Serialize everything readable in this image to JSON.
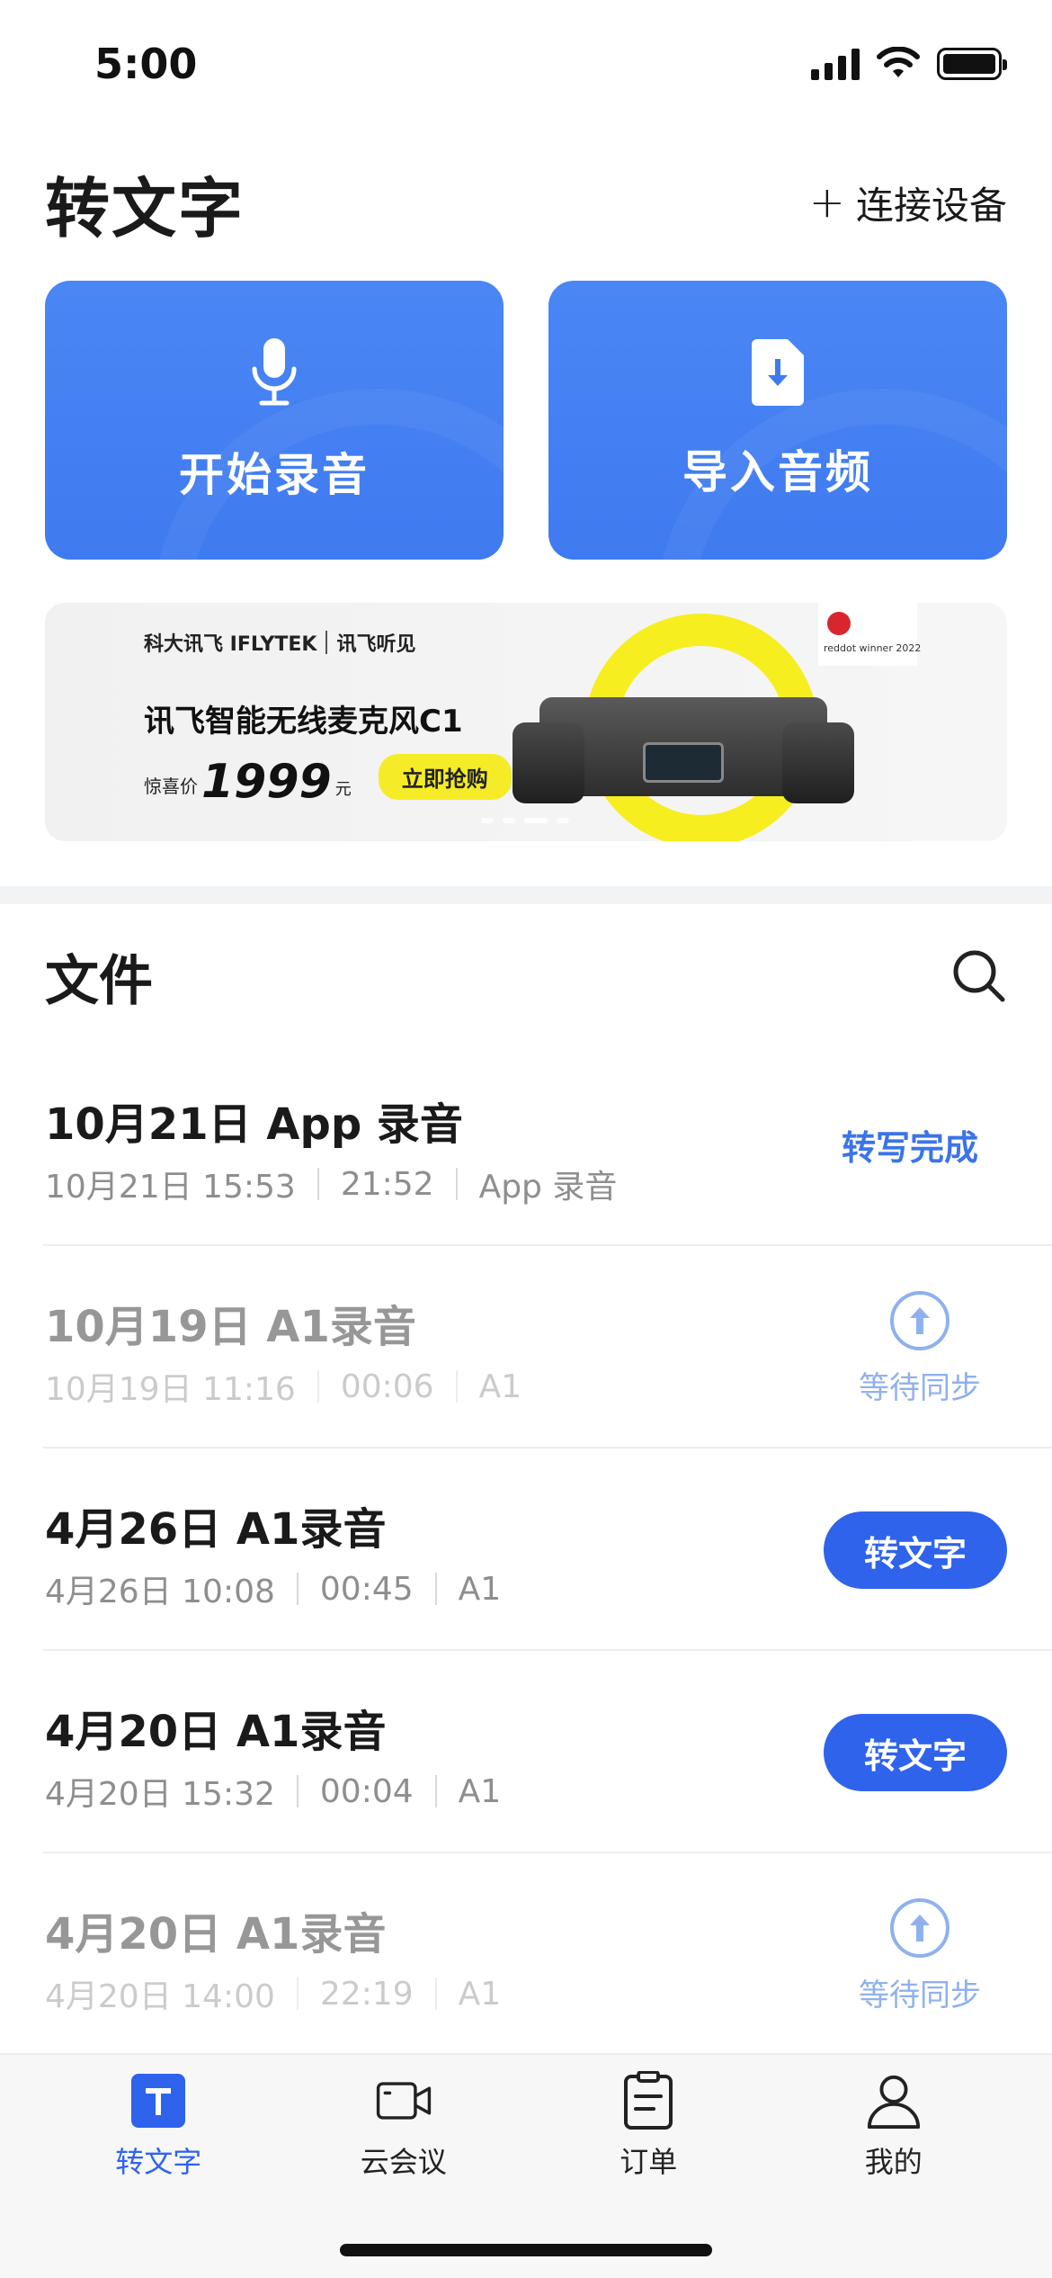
{
  "status_bar": {
    "time": "5:00"
  },
  "header": {
    "title": "转文字",
    "connect_label": "连接设备"
  },
  "actions": {
    "record_label": "开始录音",
    "import_label": "导入音频"
  },
  "banner": {
    "brand_primary": "科大讯飞 IFLYTEK",
    "brand_secondary": "讯飞听见",
    "product": "讯飞智能无线麦克风C1",
    "price_prefix": "惊喜价",
    "price": "1999",
    "price_unit": "元",
    "cta": "立即抢购",
    "award": "reddot winner 2022"
  },
  "files": {
    "title": "文件",
    "items": [
      {
        "title": "10月21日 App 录音",
        "date": "10月21日 15:53",
        "duration": "21:52",
        "source": "App 录音",
        "status": "转写完成"
      },
      {
        "title": "10月19日 A1录音",
        "date": "10月19日 11:16",
        "duration": "00:06",
        "source": "A1",
        "status": "等待同步"
      },
      {
        "title": "4月26日 A1录音",
        "date": "4月26日 10:08",
        "duration": "00:45",
        "source": "A1",
        "status": "转文字"
      },
      {
        "title": "4月20日 A1录音",
        "date": "4月20日 15:32",
        "duration": "00:04",
        "source": "A1",
        "status": "转文字"
      },
      {
        "title": "4月20日 A1录音",
        "date": "4月20日 14:00",
        "duration": "22:19",
        "source": "A1",
        "status": "等待同步"
      }
    ]
  },
  "tabs": [
    {
      "label": "转文字"
    },
    {
      "label": "云会议"
    },
    {
      "label": "订单"
    },
    {
      "label": "我的"
    }
  ],
  "colors": {
    "accent": "#2f63eb",
    "card": "#3f7bf0",
    "wait": "#8fb1ee"
  }
}
